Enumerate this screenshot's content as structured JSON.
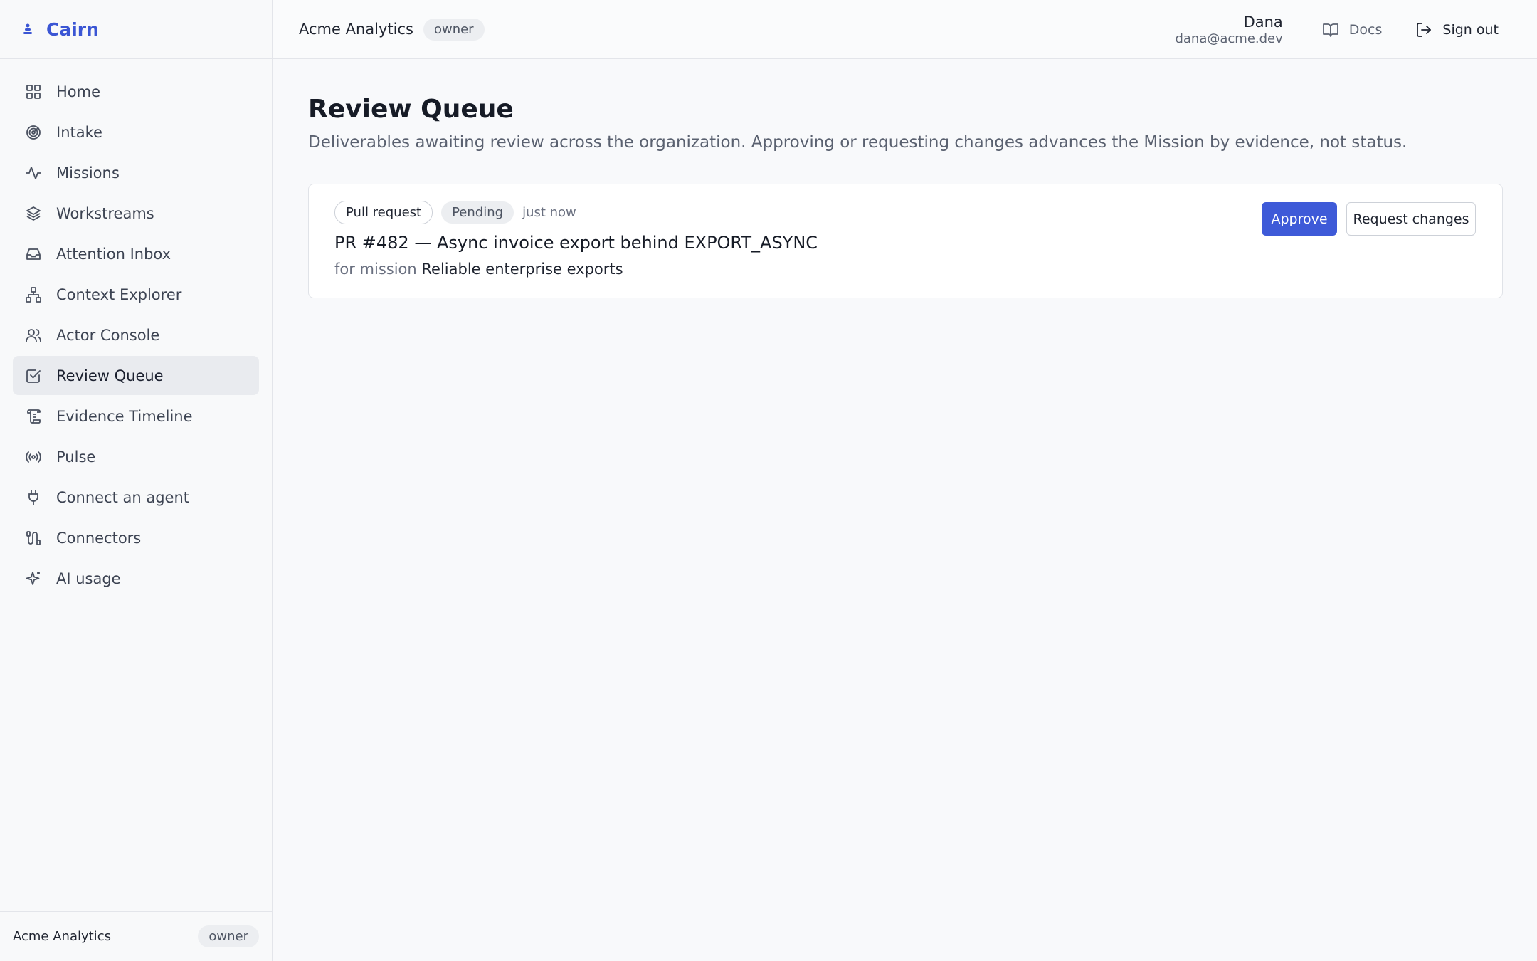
{
  "brand": {
    "name": "Cairn",
    "icon": "cairn-logo-icon"
  },
  "sidebar": {
    "items": [
      {
        "label": "Home",
        "icon": "grid-icon",
        "active": false
      },
      {
        "label": "Intake",
        "icon": "target-icon",
        "active": false
      },
      {
        "label": "Missions",
        "icon": "activity-icon",
        "active": false
      },
      {
        "label": "Workstreams",
        "icon": "layers-icon",
        "active": false
      },
      {
        "label": "Attention Inbox",
        "icon": "inbox-icon",
        "active": false
      },
      {
        "label": "Context Explorer",
        "icon": "network-icon",
        "active": false
      },
      {
        "label": "Actor Console",
        "icon": "users-icon",
        "active": false
      },
      {
        "label": "Review Queue",
        "icon": "check-square-icon",
        "active": true
      },
      {
        "label": "Evidence Timeline",
        "icon": "scroll-icon",
        "active": false
      },
      {
        "label": "Pulse",
        "icon": "radio-icon",
        "active": false
      },
      {
        "label": "Connect an agent",
        "icon": "plug-icon",
        "active": false
      },
      {
        "label": "Connectors",
        "icon": "cable-icon",
        "active": false
      },
      {
        "label": "AI usage",
        "icon": "sparkles-icon",
        "active": false
      }
    ],
    "footer": {
      "org": "Acme Analytics",
      "role": "owner"
    }
  },
  "topbar": {
    "org": "Acme Analytics",
    "role": "owner",
    "user_name": "Dana",
    "user_email": "dana@acme.dev",
    "docs_label": "Docs",
    "signout_label": "Sign out"
  },
  "page": {
    "title": "Review Queue",
    "description": "Deliverables awaiting review across the organization. Approving or requesting changes advances the Mission by evidence, not status."
  },
  "reviews": [
    {
      "type": "Pull request",
      "status": "Pending",
      "time": "just now",
      "title": "PR #482 — Async invoice export behind EXPORT_ASYNC",
      "mission_prefix": "for mission",
      "mission": "Reliable enterprise exports",
      "approve_label": "Approve",
      "changes_label": "Request changes"
    }
  ],
  "colors": {
    "accent": "#3e5ad8",
    "brand": "#3b56d4"
  }
}
